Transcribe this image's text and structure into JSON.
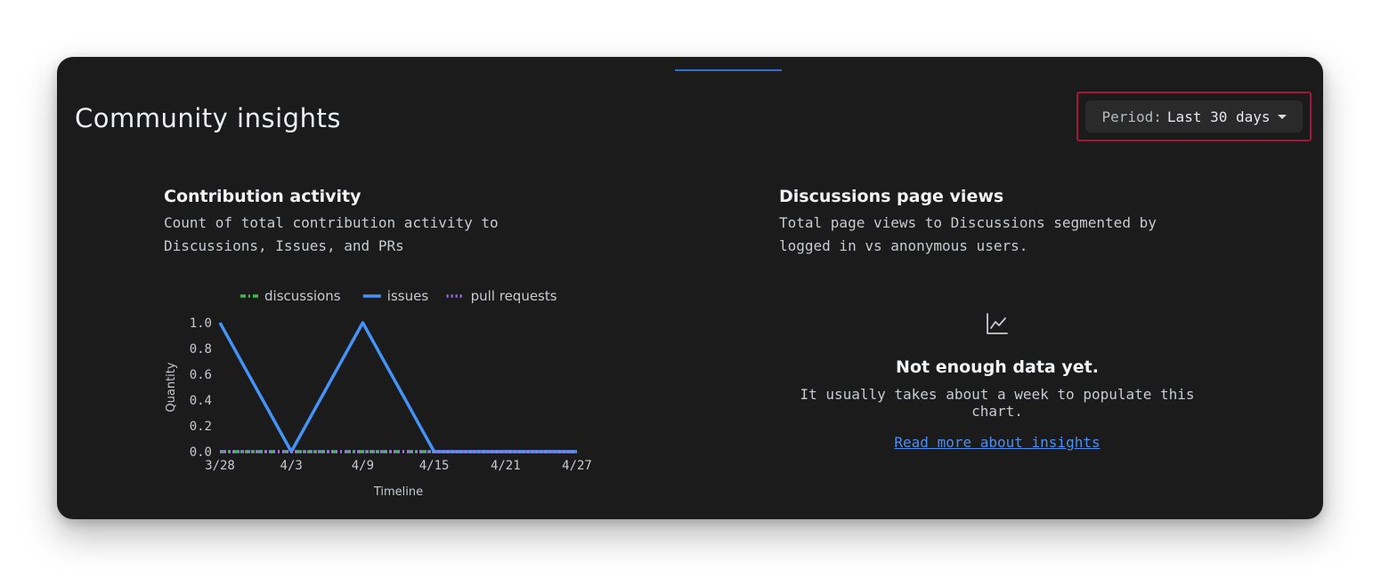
{
  "header": {
    "title": "Community insights",
    "period_prefix": "Period:",
    "period_value": "Last 30 days",
    "highlight_color": "#a4163a"
  },
  "contribution": {
    "title": "Contribution activity",
    "description": "Count of total contribution activity to Discussions, Issues, and PRs"
  },
  "chart_data": {
    "type": "line",
    "x": [
      "3/28",
      "3/29",
      "3/30",
      "3/31",
      "4/1",
      "4/2",
      "4/3",
      "4/4",
      "4/5",
      "4/6",
      "4/7",
      "4/8",
      "4/9",
      "4/10",
      "4/11",
      "4/12",
      "4/13",
      "4/14",
      "4/15",
      "4/16",
      "4/17",
      "4/18",
      "4/19",
      "4/20",
      "4/21",
      "4/22",
      "4/23",
      "4/24",
      "4/25",
      "4/26",
      "4/27"
    ],
    "x_ticks": [
      "3/28",
      "4/3",
      "4/9",
      "4/15",
      "4/21",
      "4/27"
    ],
    "y_ticks": [
      "0.0",
      "0.2",
      "0.4",
      "0.6",
      "0.8",
      "1.0"
    ],
    "ylim": [
      0,
      1
    ],
    "xlabel": "Timeline",
    "ylabel": "Quantity",
    "legend_position": "top",
    "grid": false,
    "series": [
      {
        "name": "discussions",
        "color": "#3fb950",
        "dash": "dashdot",
        "values": [
          0,
          0,
          0,
          0,
          0,
          0,
          0,
          0,
          0,
          0,
          0,
          0,
          0,
          0,
          0,
          0,
          0,
          0,
          0,
          0,
          0,
          0,
          0,
          0,
          0,
          0,
          0,
          0,
          0,
          0,
          0
        ]
      },
      {
        "name": "issues",
        "color": "#4493f8",
        "dash": "solid",
        "values": [
          1,
          0.8333,
          0.6667,
          0.5,
          0.3333,
          0.1667,
          0,
          0.1667,
          0.3333,
          0.5,
          0.6667,
          0.8333,
          1,
          0.8333,
          0.6667,
          0.5,
          0.3333,
          0.1667,
          0,
          0,
          0,
          0,
          0,
          0,
          0,
          0,
          0,
          0,
          0,
          0,
          0
        ]
      },
      {
        "name": "pull requests",
        "color": "#a371f7",
        "dash": "dotted",
        "values": [
          0,
          0,
          0,
          0,
          0,
          0,
          0,
          0,
          0,
          0,
          0,
          0,
          0,
          0,
          0,
          0,
          0,
          0,
          0,
          0,
          0,
          0,
          0,
          0,
          0,
          0,
          0,
          0,
          0,
          0,
          0
        ]
      }
    ]
  },
  "page_views": {
    "title": "Discussions page views",
    "description": "Total page views to Discussions segmented by logged in vs anonymous users.",
    "icon": "graph-icon",
    "empty_title": "Not enough data yet.",
    "empty_description": "It usually takes about a week to populate this chart.",
    "link_text": "Read more about insights"
  }
}
